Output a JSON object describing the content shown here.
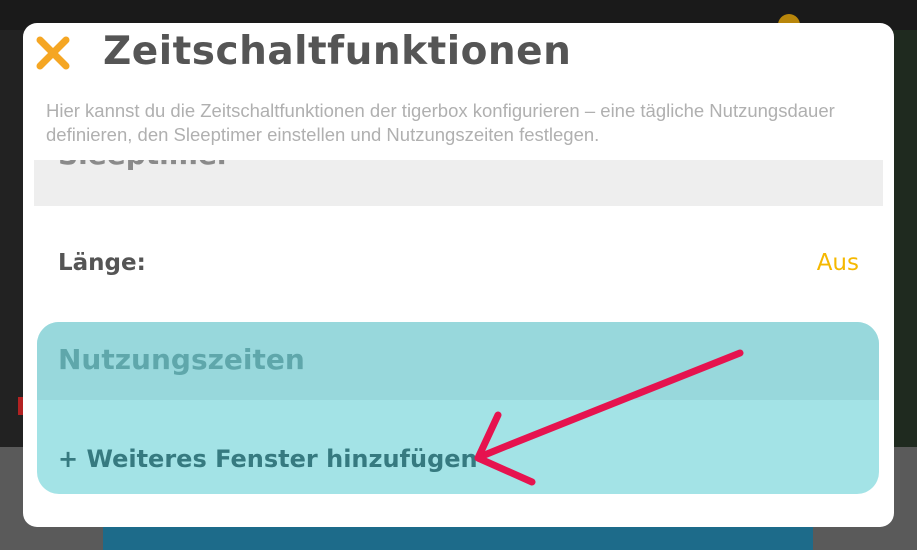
{
  "dialog": {
    "title": "Zeitschaltfunktionen",
    "close_icon": "close-icon",
    "description": "Hier kannst du die Zeitschaltfunktionen der tigerbox konfigurieren – eine tägliche Nutzungsdauer definieren, den Sleeptimer einstellen und Nutzungszeiten festlegen."
  },
  "sleeptimer": {
    "heading": "Sleeptimer",
    "length_label": "Länge:",
    "length_value": "Aus"
  },
  "nutzungszeiten": {
    "heading": "Nutzungszeiten",
    "add_window_label": "+ Weiteres Fenster hinzufügen"
  },
  "annotation": {
    "arrow_icon": "arrow-annotation-icon"
  },
  "colors": {
    "accent_orange": "#f5b800",
    "close_orange": "#f5a623",
    "teal_section": "#a3e3e6",
    "teal_header": "#98d8dc",
    "teal_text": "#367a80",
    "arrow_red": "#e6134f"
  }
}
